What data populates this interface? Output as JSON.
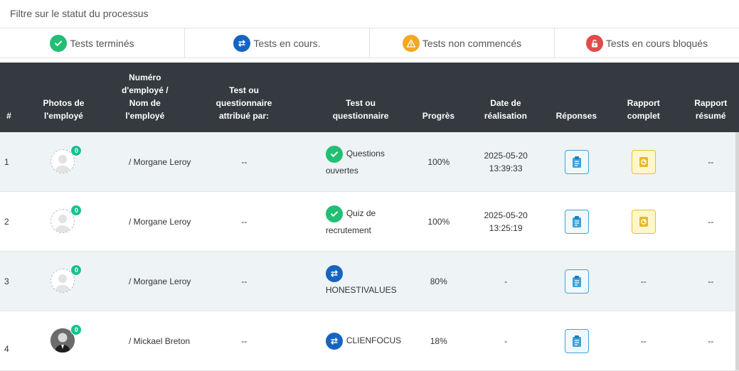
{
  "filter_title": "Filtre sur le statut du processus",
  "filters": [
    {
      "label": "Tests terminés",
      "icon": "check-circle-icon",
      "color": "#21bf73"
    },
    {
      "label": "Tests en cours.",
      "icon": "arrows-swap-icon",
      "color": "#1565c0"
    },
    {
      "label": "Tests non commencés",
      "icon": "warning-icon",
      "color": "#f5a623"
    },
    {
      "label": "Tests en cours bloqués",
      "icon": "lock-open-icon",
      "color": "#e14b4b"
    }
  ],
  "columns": {
    "num": "#",
    "photo": "Photos de l'employé",
    "employee": "Numéro d'employé / Nom de l'employé",
    "assigned_by": "Test ou questionnaire attribué par:",
    "test": "Test ou questionnaire",
    "progress": "Progrès",
    "date": "Date de réalisation",
    "answers": "Réponses",
    "full_report": "Rapport complet",
    "summary_report": "Rapport résumé"
  },
  "rows": [
    {
      "num": "1",
      "badge": "0",
      "employee": "/ Morgane Leroy",
      "assigned_by": "--",
      "test": "Questions ouvertes",
      "status": "completed",
      "progress": "100%",
      "date": "2025-05-20 13:39:33",
      "full_report": true,
      "full_report_text": "",
      "summary": "--"
    },
    {
      "num": "2",
      "badge": "0",
      "employee": "/ Morgane Leroy",
      "assigned_by": "--",
      "test": "Quiz de recrutement",
      "status": "completed",
      "progress": "100%",
      "date": "2025-05-20 13:25:19",
      "full_report": true,
      "full_report_text": "",
      "summary": "--"
    },
    {
      "num": "3",
      "badge": "0",
      "employee": "/ Morgane Leroy",
      "assigned_by": "--",
      "test": "HONESTIVALUES",
      "status": "in_progress",
      "progress": "80%",
      "date": "-",
      "full_report": false,
      "full_report_text": "--",
      "summary": "--"
    },
    {
      "num": "4",
      "badge": "0",
      "employee": "/ Mickael Breton",
      "assigned_by": "--",
      "test": "CLIENFOCUS",
      "status": "in_progress",
      "progress": "18%",
      "date": "-",
      "full_report": false,
      "full_report_text": "--",
      "summary": "--"
    }
  ]
}
